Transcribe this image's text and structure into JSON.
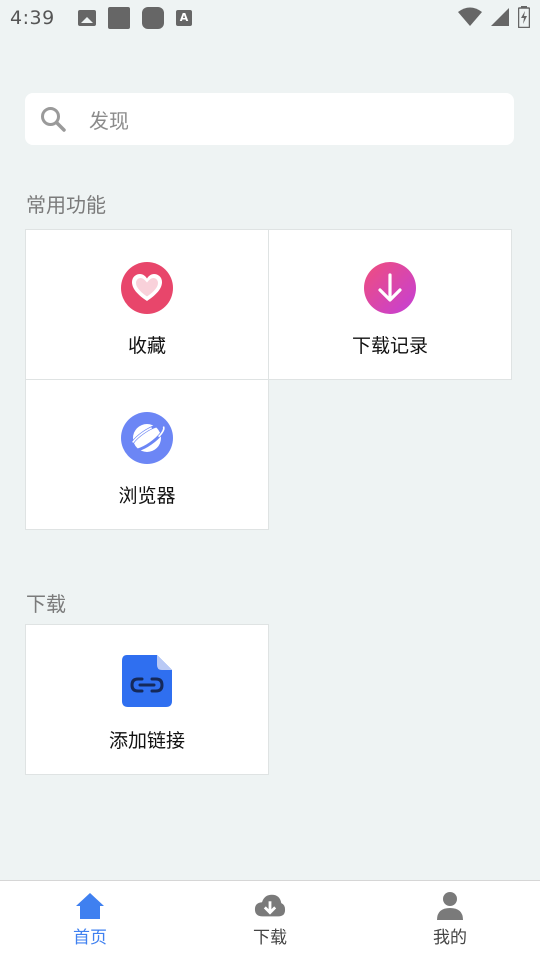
{
  "status_bar": {
    "time": "4:39",
    "icons": [
      "image-icon",
      "square-icon",
      "rounded-square-icon",
      "a-icon",
      "wifi-icon",
      "signal-icon",
      "battery-charging-icon"
    ],
    "a_icon_text": "A"
  },
  "search": {
    "placeholder": "发现"
  },
  "sections": {
    "common": {
      "title": "常用功能",
      "items": [
        {
          "label": "收藏",
          "icon": "heart-icon"
        },
        {
          "label": "下载记录",
          "icon": "download-arrow-icon"
        },
        {
          "label": "浏览器",
          "icon": "planet-icon"
        }
      ]
    },
    "download": {
      "title": "下载",
      "items": [
        {
          "label": "添加链接",
          "icon": "link-file-icon"
        }
      ]
    }
  },
  "bottom_nav": {
    "items": [
      {
        "label": "首页",
        "icon": "home-icon",
        "active": true
      },
      {
        "label": "下载",
        "icon": "cloud-download-icon",
        "active": false
      },
      {
        "label": "我的",
        "icon": "person-icon",
        "active": false
      }
    ]
  },
  "colors": {
    "accent": "#3f80f0",
    "background": "#eef3f3",
    "heart": "#e8466b",
    "download_gradient_start": "#f04e7c",
    "download_gradient_end": "#c43fd8",
    "planet": "#6c86f5",
    "link_file": "#2f6ff0"
  }
}
